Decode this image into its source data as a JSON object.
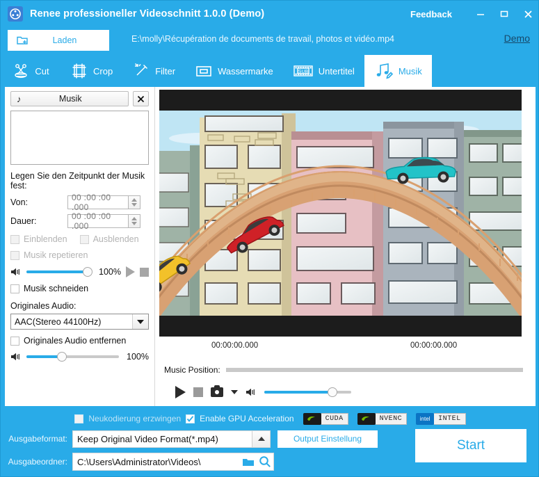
{
  "window": {
    "title": "Renee professioneller Videoschnitt 1.0.0 (Demo)",
    "logo_icon": "film-reel-icon",
    "feedback": "Feedback",
    "minimize_icon": "minimize-icon",
    "maximize_icon": "maximize-icon",
    "close_icon": "close-icon",
    "accent": "#29ABE8"
  },
  "loadbar": {
    "load_label": "Laden",
    "load_icon": "add-file-icon",
    "file_path": "E:\\molly\\Récupération de documents de travail, photos et vidéo.mp4",
    "demo_label": "Demo"
  },
  "tabs": [
    {
      "label": "Cut",
      "icon": "scissors-icon",
      "active": false
    },
    {
      "label": "Crop",
      "icon": "film-frame-icon",
      "active": false
    },
    {
      "label": "Filter",
      "icon": "magic-wand-icon",
      "active": false
    },
    {
      "label": "Wassermarke",
      "icon": "watermark-frame-icon",
      "active": false
    },
    {
      "label": "Untertitel",
      "icon": "sub-film-icon",
      "active": false
    },
    {
      "label": "Musik",
      "icon": "music-note-pencil-icon",
      "active": true
    }
  ],
  "music_panel": {
    "tab_label": "Musik",
    "tab_icon": "music-note-icon",
    "close_icon": "close-icon",
    "list_items": [],
    "time_hint": "Legen Sie den Zeitpunkt der Musik fest:",
    "von_label": "Von:",
    "von_value": "00 :00 :00 .000",
    "dauer_label": "Dauer:",
    "dauer_value": "00 :00 :00 .000",
    "fade_in_label": "Einblenden",
    "fade_in_checked": false,
    "fade_in_enabled": false,
    "fade_out_label": "Ausblenden",
    "fade_out_checked": false,
    "fade_out_enabled": false,
    "repeat_label": "Musik repetieren",
    "repeat_checked": false,
    "repeat_enabled": false,
    "music_volume": "100%",
    "music_volume_pct": 100,
    "music_play_icon": "play-icon",
    "music_stop_icon": "stop-icon",
    "trim_label": "Musik schneiden",
    "trim_checked": false,
    "original_audio_label": "Originales Audio:",
    "original_audio_value": "AAC(Stereo 44100Hz)",
    "remove_original_label": "Originales Audio entfernen",
    "remove_original_checked": false,
    "original_volume": "100%",
    "original_volume_pct": 38,
    "speaker_icon": "speaker-icon"
  },
  "preview": {
    "time_current": "00:00:00.000",
    "time_total": "00:00:00.000",
    "music_position_label": "Music Position:",
    "music_position_pct": 0,
    "play_icon": "play-icon",
    "stop_icon": "stop-icon",
    "snapshot_icon": "camera-icon",
    "snapshot_dropdown_icon": "chevron-down-icon",
    "volume_icon": "speaker-icon",
    "volume_pct": 78
  },
  "gpu": {
    "force_reencode_label": "Neukodierung erzwingen",
    "force_reencode_checked": false,
    "enable_gpu_label": "Enable GPU Acceleration",
    "enable_gpu_checked": true,
    "chips": [
      {
        "name": "CUDA",
        "icon": "nvidia-icon"
      },
      {
        "name": "NVENC",
        "icon": "nvidia-icon"
      },
      {
        "name": "INTEL",
        "icon": "intel-icon"
      }
    ]
  },
  "output": {
    "format_label": "Ausgabeformat:",
    "format_value": "Keep Original Video Format(*.mp4)",
    "format_arrow_icon": "chevron-up-icon",
    "settings_label": "Output Einstellung",
    "folder_label": "Ausgabeordner:",
    "folder_value": "C:\\Users\\Administrator\\Videos\\",
    "folder_icon": "folder-icon",
    "search_icon": "search-icon",
    "start_label": "Start"
  }
}
